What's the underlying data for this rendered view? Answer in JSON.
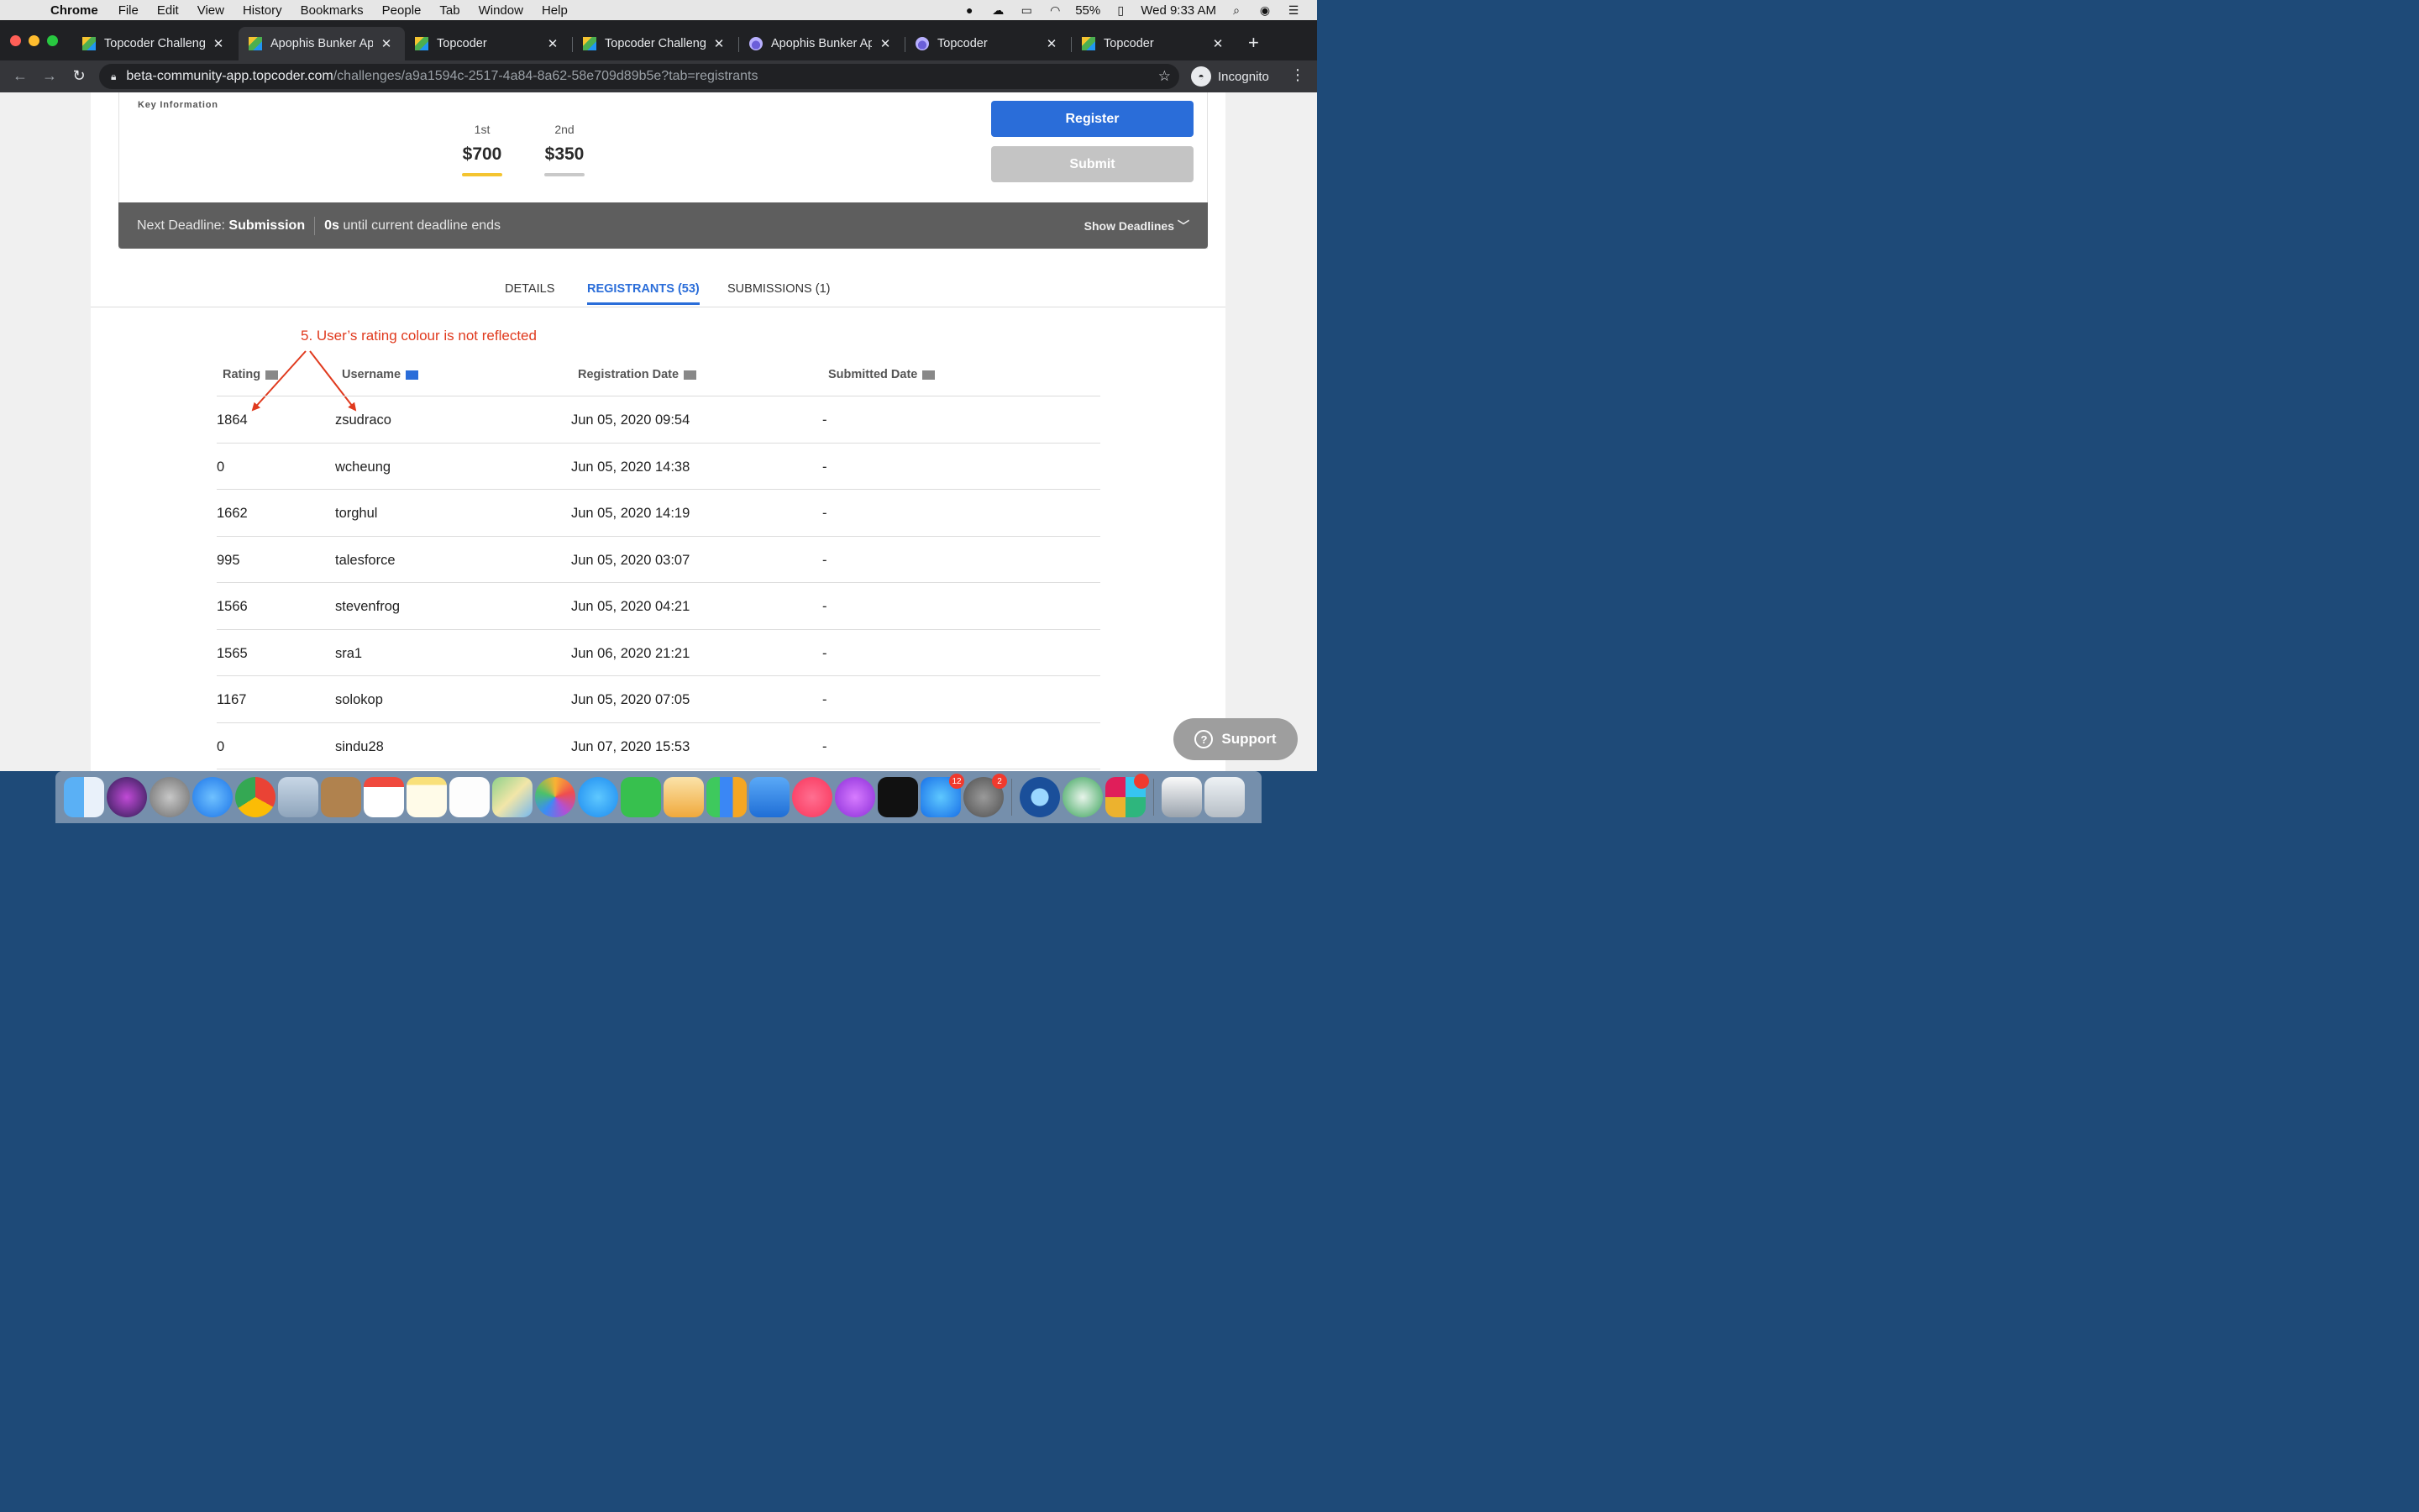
{
  "menubar": {
    "app": "Chrome",
    "items": [
      "File",
      "Edit",
      "View",
      "History",
      "Bookmarks",
      "People",
      "Tab",
      "Window",
      "Help"
    ],
    "battery": "55%",
    "clock": "Wed 9:33 AM"
  },
  "tabs": [
    {
      "title": "Topcoder Challenges",
      "favicon": "topcoder"
    },
    {
      "title": "Apophis Bunker App",
      "favicon": "topcoder",
      "active": true
    },
    {
      "title": "Topcoder",
      "favicon": "topcoder"
    },
    {
      "title": "Topcoder Challenges",
      "favicon": "topcoder"
    },
    {
      "title": "Apophis Bunker App",
      "favicon": "apophis"
    },
    {
      "title": "Topcoder",
      "favicon": "apophis"
    },
    {
      "title": "Topcoder",
      "favicon": "topcoder"
    }
  ],
  "address": {
    "host": "beta-community-app.topcoder.com",
    "path": "/challenges/a9a1594c-2517-4a84-8a62-58e709d89b5e?tab=registrants"
  },
  "profile": "Incognito",
  "challenge": {
    "key_info_label": "Key Information",
    "prizes": [
      {
        "place": "1st",
        "amount": "$700",
        "color": "#f4c430"
      },
      {
        "place": "2nd",
        "amount": "$350",
        "color": "#c9c9c9"
      }
    ],
    "register_label": "Register",
    "submit_label": "Submit",
    "deadline_prefix": "Next Deadline:",
    "deadline_name": "Submission",
    "deadline_time": "0s",
    "deadline_suffix": "until current deadline ends",
    "show_deadlines": "Show Deadlines"
  },
  "page_tabs": [
    {
      "label": "DETAILS"
    },
    {
      "label": "REGISTRANTS (53)",
      "active": true
    },
    {
      "label": "SUBMISSIONS (1)"
    }
  ],
  "annotation": "5. User’s rating colour is not reflected",
  "table": {
    "headers": [
      "Rating",
      "Username",
      "Registration Date",
      "Submitted Date"
    ],
    "rows": [
      {
        "rating": "1864",
        "username": "zsudraco",
        "registered": "Jun 05, 2020 09:54",
        "submitted": "-"
      },
      {
        "rating": "0",
        "username": "wcheung",
        "registered": "Jun 05, 2020 14:38",
        "submitted": "-"
      },
      {
        "rating": "1662",
        "username": "torghul",
        "registered": "Jun 05, 2020 14:19",
        "submitted": "-"
      },
      {
        "rating": "995",
        "username": "talesforce",
        "registered": "Jun 05, 2020 03:07",
        "submitted": "-"
      },
      {
        "rating": "1566",
        "username": "stevenfrog",
        "registered": "Jun 05, 2020 04:21",
        "submitted": "-"
      },
      {
        "rating": "1565",
        "username": "sra1",
        "registered": "Jun 06, 2020 21:21",
        "submitted": "-"
      },
      {
        "rating": "1167",
        "username": "solokop",
        "registered": "Jun 05, 2020 07:05",
        "submitted": "-"
      },
      {
        "rating": "0",
        "username": "sindu28",
        "registered": "Jun 07, 2020 15:53",
        "submitted": "-"
      }
    ]
  },
  "support_label": "Support",
  "dock": {
    "badges": {
      "app-store": "12",
      "system-preferences": "2"
    }
  }
}
